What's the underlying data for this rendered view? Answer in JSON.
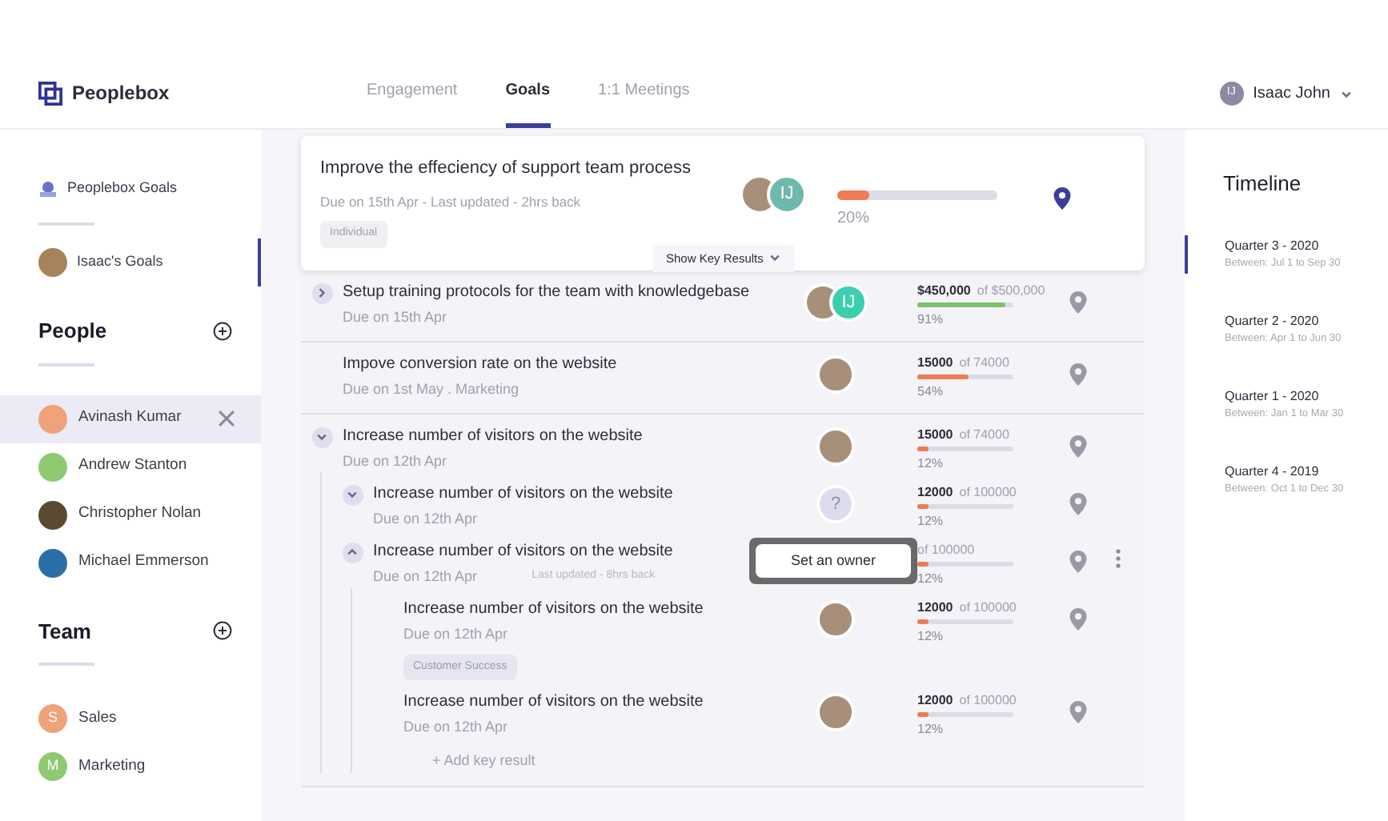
{
  "brand": {
    "name": "Peoplebox"
  },
  "tabs": [
    {
      "label": "Engagement",
      "selected": false
    },
    {
      "label": "Goals",
      "selected": true
    },
    {
      "label": "1:1 Meetings",
      "selected": false
    }
  ],
  "user": {
    "initials": "IJ",
    "name": "Isaac John"
  },
  "sidebar": {
    "nav": [
      {
        "label": "Peoplebox Goals",
        "kind": "goals",
        "selected": false
      },
      {
        "label": "Isaac's Goals",
        "kind": "avatar",
        "selected": true
      }
    ],
    "people": {
      "title": "People",
      "items": [
        {
          "name": "Avinash Kumar",
          "color": "#f0a27a",
          "selected": true
        },
        {
          "name": "Andrew Stanton",
          "color": "#8fca72",
          "selected": false
        },
        {
          "name": "Christopher Nolan",
          "color": "#5b4a32",
          "selected": false
        },
        {
          "name": "Michael Emmerson",
          "color": "#2a6fa8",
          "selected": false
        }
      ]
    },
    "team": {
      "title": "Team",
      "items": [
        {
          "initial": "S",
          "name": "Sales",
          "color": "#f0a27a"
        },
        {
          "initial": "M",
          "name": "Marketing",
          "color": "#8fca72"
        }
      ]
    }
  },
  "focus_goal": {
    "title": "Improve the effeciency of support team process",
    "meta": "Due on 15th Apr - Last updated - 2hrs back",
    "tag": "Individual",
    "owners": [
      {
        "kind": "photo"
      },
      {
        "kind": "initials",
        "initials": "IJ",
        "color": "#6fb8ae"
      }
    ],
    "level": 0.2,
    "percent": "20%",
    "button": "Show Key Results"
  },
  "goals": [
    {
      "kind": "right",
      "title": "Setup training protocols for the team with knowledgebase",
      "meta": "Due on 15th Apr",
      "owners": [
        {
          "kind": "photo"
        },
        {
          "kind": "initials",
          "initials": "IJ",
          "color": "#3ccfae"
        }
      ],
      "current": "$450,000",
      "target": "of $500,000",
      "level": 0.91,
      "color": "#7cc36a",
      "percent": "91%"
    },
    {
      "title": "Impove conversion rate on the website",
      "meta": "Due on 1st May . Marketing",
      "owners": [
        {
          "kind": "photo"
        }
      ],
      "current": "15000",
      "target": "of 74000",
      "level": 0.54,
      "color": "#ee7b55",
      "percent": "54%"
    },
    {
      "kind": "down",
      "title": "Increase number of visitors on the website",
      "meta": "Due on 12th Apr",
      "owners": [
        {
          "kind": "photo"
        }
      ],
      "current": "15000",
      "target": "of 74000",
      "level": 0.12,
      "color": "#ee7b55",
      "percent": "12%",
      "children": [
        {
          "kind": "down",
          "title": "Increase number of visitors on the website",
          "meta": "Due on 12th Apr",
          "owners": [
            {
              "kind": "unknown",
              "initials": "?"
            }
          ],
          "tooltip": "Set an owner",
          "current": "12000",
          "target": "of 100000",
          "level": 0.12,
          "color": "#ee7b55",
          "percent": "12%"
        },
        {
          "kind": "up",
          "title": "Increase number of visitors on the website",
          "meta": "Due on 12th Apr",
          "updated": "Last updated - 8hrs back",
          "menu": true,
          "target": "of 100000",
          "level": 0.12,
          "color": "#ee7b55",
          "percent": "12%",
          "children": [
            {
              "title": "Increase number of visitors on the website",
              "meta": "Due on 12th Apr",
              "tag": "Customer Success",
              "owners": [
                {
                  "kind": "photo"
                }
              ],
              "current": "12000",
              "target": "of 100000",
              "level": 0.12,
              "color": "#ee7b55",
              "percent": "12%"
            },
            {
              "title": "Increase number of visitors on the website",
              "meta": "Due on 12th Apr",
              "owners": [
                {
                  "kind": "photo"
                }
              ],
              "current": "12000",
              "target": "of 100000",
              "level": 0.12,
              "color": "#ee7b55",
              "percent": "12%"
            }
          ],
          "add_label": "+ Add key result"
        }
      ]
    }
  ],
  "timeline": {
    "title": "Timeline",
    "items": [
      {
        "label": "Quarter 3 - 2020",
        "range": "Between: Jul 1 to Sep 30",
        "selected": true
      },
      {
        "label": "Quarter 2 - 2020",
        "range": "Between: Apr 1 to Jun 30",
        "selected": false
      },
      {
        "label": "Quarter 1 - 2020",
        "range": "Between: Jan 1 to Mar 30",
        "selected": false
      },
      {
        "label": "Quarter 4 - 2019",
        "range": "Between: Oct 1 to Dec 30",
        "selected": false
      }
    ]
  }
}
